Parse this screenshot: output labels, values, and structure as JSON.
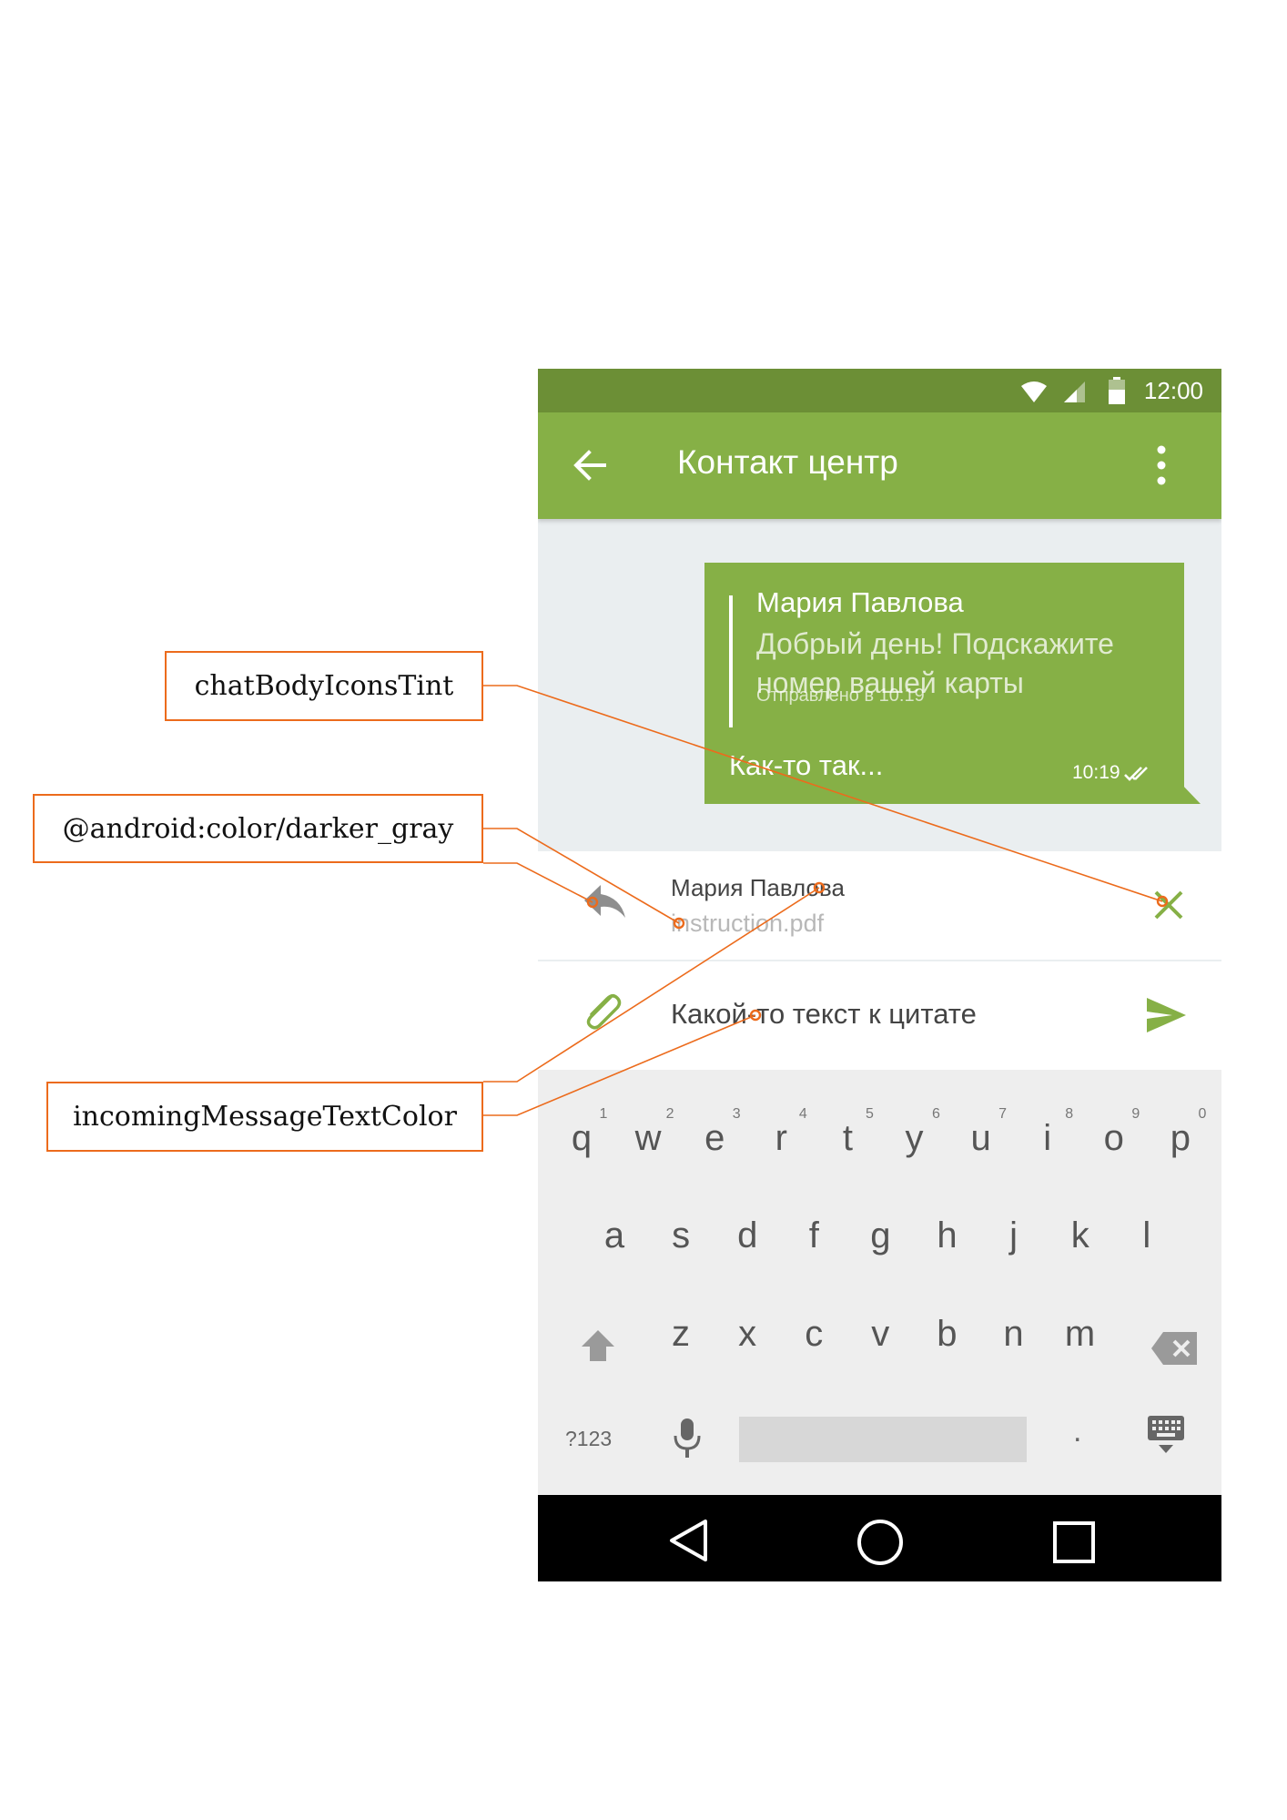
{
  "status_bar": {
    "time": "12:00"
  },
  "app_bar": {
    "title": "Контакт центр"
  },
  "message": {
    "quote": {
      "author": "Мария Павлова",
      "text": "Добрый день! Подскажите номер вашей карты",
      "sent_label": "Отправлено в 10:19"
    },
    "text": "Как-то так...",
    "time": "10:19"
  },
  "reply_preview": {
    "author": "Мария Павлова",
    "file": "instruction.pdf"
  },
  "composer": {
    "text": "Какой-то текст к цитате"
  },
  "keyboard": {
    "row1": [
      "q",
      "w",
      "e",
      "r",
      "t",
      "y",
      "u",
      "i",
      "o",
      "p"
    ],
    "row1_hints": [
      "1",
      "2",
      "3",
      "4",
      "5",
      "6",
      "7",
      "8",
      "9",
      "0"
    ],
    "row2": [
      "a",
      "s",
      "d",
      "f",
      "g",
      "h",
      "j",
      "k",
      "l"
    ],
    "row3": [
      "z",
      "x",
      "c",
      "v",
      "b",
      "n",
      "m"
    ],
    "symbols_key": "?123",
    "period_key": "."
  },
  "annotations": [
    {
      "label": "chatBodyIconsTint"
    },
    {
      "label": "@android:color/darker_gray"
    },
    {
      "label": "incomingMessageTextColor"
    }
  ],
  "colors": {
    "status_bar": "#6c8f36",
    "app_bar": "#86b046",
    "chat_background": "#eaeef0",
    "icons_tint": "#86b046",
    "annotation": "#ec6b1c"
  }
}
